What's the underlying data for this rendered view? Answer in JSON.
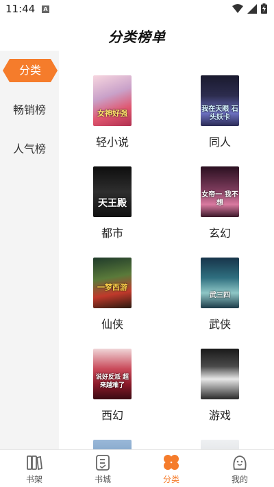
{
  "status_bar": {
    "time": "11:44",
    "notification_badge": "A"
  },
  "page": {
    "title": "分类榜单"
  },
  "colors": {
    "accent": "#f57c2b",
    "sidebar_bg": "#f4f4f4",
    "text": "#222222"
  },
  "sidebar": {
    "items": [
      {
        "label": "分类",
        "active": true
      },
      {
        "label": "畅销榜",
        "active": false
      },
      {
        "label": "人气榜",
        "active": false
      }
    ]
  },
  "categories": [
    {
      "label": "轻小说",
      "cover_text": "女神好强"
    },
    {
      "label": "同人",
      "cover_text": "我在天眼 石头妖卡"
    },
    {
      "label": "都市",
      "cover_text": "天王殿"
    },
    {
      "label": "玄幻",
      "cover_text": "女帝一 我不想"
    },
    {
      "label": "仙侠",
      "cover_text": "一梦西游"
    },
    {
      "label": "武侠",
      "cover_text": "武三四"
    },
    {
      "label": "西幻",
      "cover_text": "说好反派 超来越难了"
    },
    {
      "label": "游戏",
      "cover_text": ""
    }
  ],
  "bottom_nav": {
    "items": [
      {
        "label": "书架",
        "icon": "bookshelf-icon",
        "active": false
      },
      {
        "label": "书城",
        "icon": "bookstore-icon",
        "active": false
      },
      {
        "label": "分类",
        "icon": "category-icon",
        "active": true
      },
      {
        "label": "我的",
        "icon": "profile-icon",
        "active": false
      }
    ]
  }
}
